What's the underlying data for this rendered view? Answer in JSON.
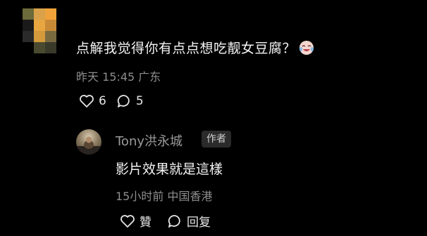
{
  "comment": {
    "text": "点解我觉得你有点点想吃靓女豆腐？",
    "timestamp": "昨天 15:45 广东",
    "likes": "6",
    "replies": "5",
    "avatar_colors": [
      "#6b6a3a",
      "#d9a24a",
      "#f0a23a",
      "#1a1a1a",
      "#e8a640",
      "#c98a38",
      "#2a2a2a",
      "#d49a3c",
      "#7a6a40",
      "#000000",
      "#4a4a30",
      "#3a3a2a"
    ]
  },
  "reply": {
    "author": "Tony洪永城",
    "badge": "作者",
    "text": "影片效果就是這樣",
    "timestamp": "15小时前 中国香港",
    "like_label": "贊",
    "reply_label": "回复"
  },
  "icons": [
    "heart-icon",
    "comment-bubble-icon",
    "crying-laugh-emoji"
  ]
}
